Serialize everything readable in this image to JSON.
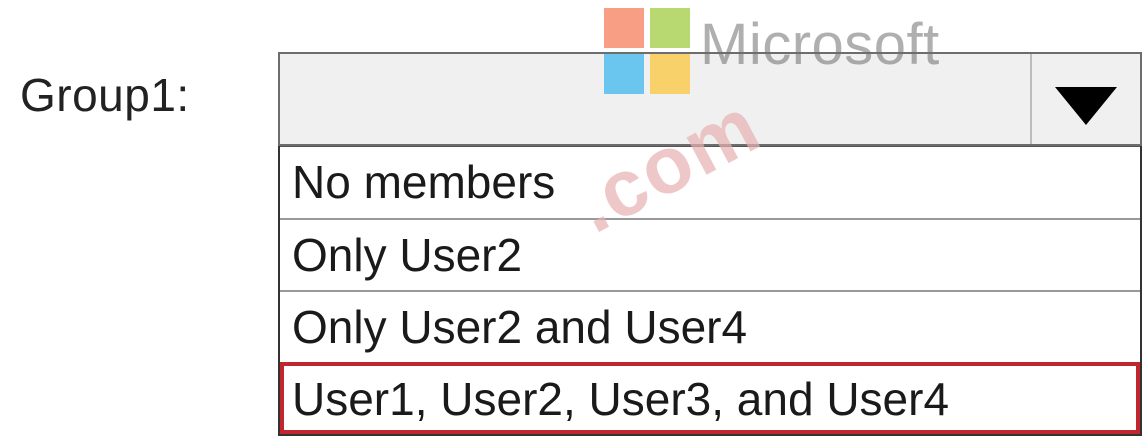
{
  "form": {
    "label": "Group1:",
    "selected_value": "",
    "options": [
      "No members",
      "Only User2",
      "Only User2 and User4",
      "User1, User2, User3, and User4"
    ],
    "highlighted_option_index": 3
  },
  "watermark": {
    "logo_text": "Microsoft",
    "logo_colors": [
      "#f25022",
      "#7fba00",
      "#00a4ef",
      "#ffb900"
    ],
    "overlay_text": ".com"
  },
  "colors": {
    "highlight_border": "#c0262d"
  },
  "icons": {
    "dropdown": "chevron-down-icon"
  }
}
